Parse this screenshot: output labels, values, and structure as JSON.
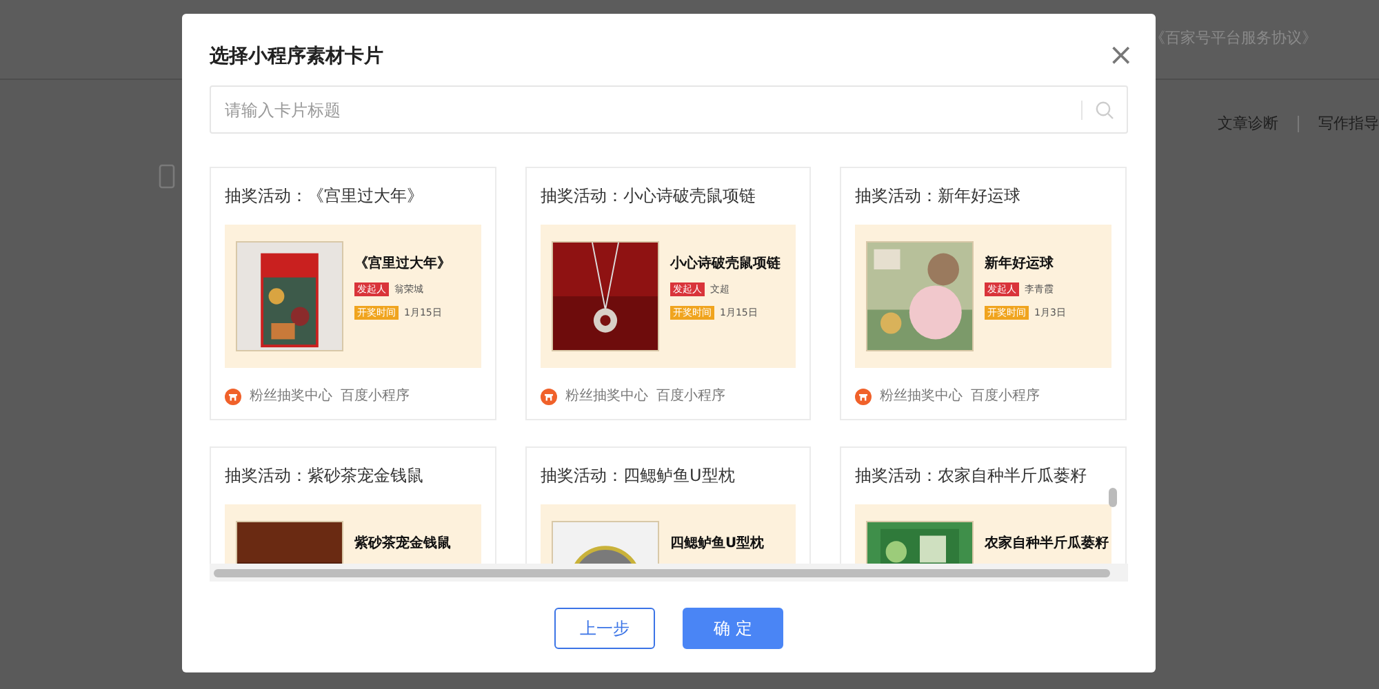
{
  "background": {
    "agreement_link": "《百家号平台服务协议》",
    "toolbar": [
      "文章诊断",
      "写作指导"
    ]
  },
  "dialog": {
    "title": "选择小程序素材卡片",
    "close": "×",
    "search": {
      "placeholder": "请输入卡片标题"
    },
    "cards": [
      {
        "title": "抽奖活动：《宫里过大年》",
        "poster_title": "《宫里过大年》",
        "initiator_tag": "发起人",
        "initiator": "翁荣城",
        "time_tag": "开奖时间",
        "date": "1月15日",
        "source": "粉丝抽奖中心",
        "platform": "百度小程序"
      },
      {
        "title": "抽奖活动：小心诗破壳鼠项链",
        "poster_title": "小心诗破壳鼠项链",
        "initiator_tag": "发起人",
        "initiator": "文超",
        "time_tag": "开奖时间",
        "date": "1月15日",
        "source": "粉丝抽奖中心",
        "platform": "百度小程序"
      },
      {
        "title": "抽奖活动：新年好运球",
        "poster_title": "新年好运球",
        "initiator_tag": "发起人",
        "initiator": "李青霞",
        "time_tag": "开奖时间",
        "date": "1月3日",
        "source": "粉丝抽奖中心",
        "platform": "百度小程序"
      },
      {
        "title": "抽奖活动：紫砂茶宠金钱鼠",
        "poster_title": "紫砂茶宠金钱鼠"
      },
      {
        "title": "抽奖活动：四鳃鲈鱼U型枕",
        "poster_title": "四鳃鲈鱼U型枕"
      },
      {
        "title": "抽奖活动：农家自种半斤瓜蒌籽",
        "poster_title": "农家自种半斤瓜蒌籽"
      }
    ],
    "buttons": [
      {
        "label": "上一步",
        "kind": "secondary"
      },
      {
        "label": "确 定",
        "kind": "primary"
      }
    ]
  }
}
